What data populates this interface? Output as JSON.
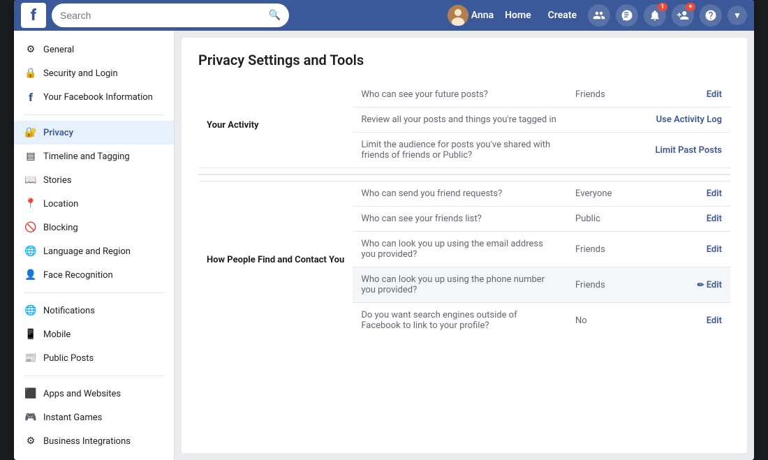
{
  "topnav": {
    "logo": "f",
    "search_placeholder": "Search",
    "user_name": "Anna",
    "nav_links": [
      "Home",
      "Create"
    ],
    "icons": [
      "people",
      "messenger",
      "notifications",
      "friend-requests",
      "help",
      "dropdown"
    ]
  },
  "sidebar": {
    "items": [
      {
        "id": "general",
        "label": "General",
        "icon": "⚙",
        "active": false
      },
      {
        "id": "security",
        "label": "Security and Login",
        "icon": "🔒",
        "active": false
      },
      {
        "id": "facebook-info",
        "label": "Your Facebook Information",
        "icon": "🔵",
        "active": false
      },
      {
        "id": "privacy",
        "label": "Privacy",
        "icon": "🔐",
        "active": true
      },
      {
        "id": "timeline",
        "label": "Timeline and Tagging",
        "icon": "▤",
        "active": false
      },
      {
        "id": "stories",
        "label": "Stories",
        "icon": "📖",
        "active": false
      },
      {
        "id": "location",
        "label": "Location",
        "icon": "📍",
        "active": false
      },
      {
        "id": "blocking",
        "label": "Blocking",
        "icon": "🚫",
        "active": false
      },
      {
        "id": "language",
        "label": "Language and Region",
        "icon": "🌐",
        "active": false
      },
      {
        "id": "face",
        "label": "Face Recognition",
        "icon": "👤",
        "active": false
      },
      {
        "id": "notifications",
        "label": "Notifications",
        "icon": "🌐",
        "active": false
      },
      {
        "id": "mobile",
        "label": "Mobile",
        "icon": "📱",
        "active": false
      },
      {
        "id": "public-posts",
        "label": "Public Posts",
        "icon": "📰",
        "active": false
      },
      {
        "id": "apps",
        "label": "Apps and Websites",
        "icon": "⬛",
        "active": false
      },
      {
        "id": "instant-games",
        "label": "Instant Games",
        "icon": "🎮",
        "active": false
      },
      {
        "id": "business",
        "label": "Business Integrations",
        "icon": "⚙",
        "active": false
      }
    ],
    "divider_after": [
      2,
      9,
      11
    ]
  },
  "content": {
    "title": "Privacy Settings and Tools",
    "sections": [
      {
        "id": "your-activity",
        "label": "Your Activity",
        "rows": [
          {
            "desc": "Who can see your future posts?",
            "value": "Friends",
            "action": "Edit",
            "highlighted": false
          },
          {
            "desc": "Review all your posts and things you're tagged in",
            "value": "",
            "action": "Use Activity Log",
            "highlighted": false
          },
          {
            "desc": "Limit the audience for posts you've shared with friends of friends or Public?",
            "value": "",
            "action": "Limit Past Posts",
            "highlighted": false
          }
        ]
      },
      {
        "id": "find-contact",
        "label": "How People Find and Contact You",
        "rows": [
          {
            "desc": "Who can send you friend requests?",
            "value": "Everyone",
            "action": "Edit",
            "highlighted": false
          },
          {
            "desc": "Who can see your friends list?",
            "value": "Public",
            "action": "Edit",
            "highlighted": false
          },
          {
            "desc": "Who can look you up using the email address you provided?",
            "value": "Friends",
            "action": "Edit",
            "highlighted": false
          },
          {
            "desc": "Who can look you up using the phone number you provided?",
            "value": "Friends",
            "action": "Edit",
            "highlighted": true,
            "edit_icon": true
          },
          {
            "desc": "Do you want search engines outside of Facebook to link to your profile?",
            "value": "No",
            "action": "Edit",
            "highlighted": false
          }
        ]
      }
    ]
  },
  "notifications": {
    "count": "1"
  }
}
